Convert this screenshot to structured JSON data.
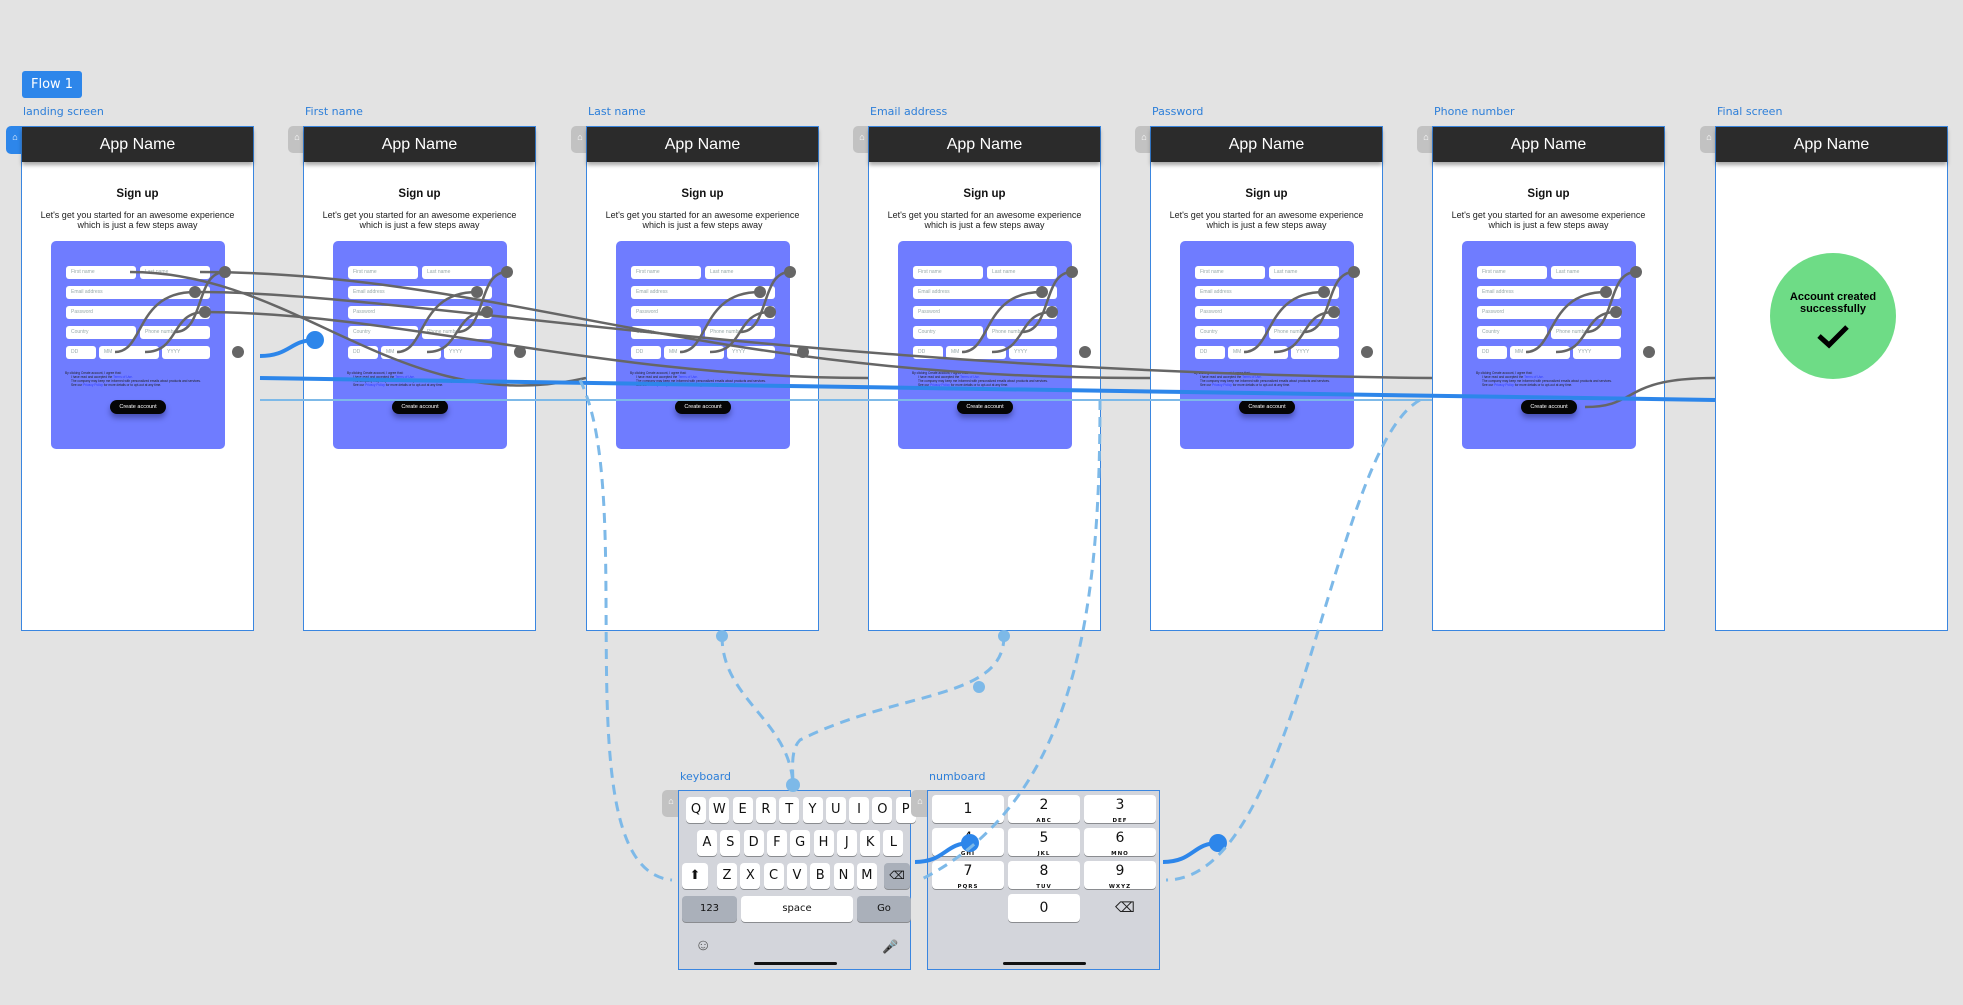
{
  "flow": {
    "label": "Flow 1"
  },
  "app_name": "App Name",
  "signup": {
    "title": "Sign up",
    "subtitle_line1": "Let's get you started for an awesome experience",
    "subtitle_line2": "which is just a few steps away",
    "placeholders": {
      "first_name": "First name",
      "last_name": "Last name",
      "email": "Email address",
      "password": "Password",
      "country": "Country",
      "phone": "Phone number",
      "day": "DD",
      "month": "MM",
      "year": "YYYY"
    },
    "legal": {
      "intro": "By clicking Create account, I agree that:",
      "line1_prefix": "I have read and accepted the ",
      "line1_link": "Terms of Use.",
      "line2": "The company may keep me informed with personalized emails about products and services.",
      "line3_prefix": "See our ",
      "line3_link": "Privacy Policy",
      "line3_suffix": " for more details or to opt-out at any time."
    },
    "create_button": "Create account"
  },
  "screens": [
    {
      "label": "landing screen",
      "is_start": true
    },
    {
      "label": "First name"
    },
    {
      "label": "Last name"
    },
    {
      "label": "Email address"
    },
    {
      "label": "Password"
    },
    {
      "label": "Phone number"
    },
    {
      "label": "Final screen"
    }
  ],
  "final_screen": {
    "message_line1": "Account created",
    "message_line2": "successfully",
    "icon": "checkmark-icon"
  },
  "keyboard": {
    "label": "keyboard",
    "row1": [
      "Q",
      "W",
      "E",
      "R",
      "T",
      "Y",
      "U",
      "I",
      "O",
      "P"
    ],
    "row2": [
      "A",
      "S",
      "D",
      "F",
      "G",
      "H",
      "J",
      "K",
      "L"
    ],
    "row3": [
      "Z",
      "X",
      "C",
      "V",
      "B",
      "N",
      "M"
    ],
    "numbers_key": "123",
    "space_key": "space",
    "go_key": "Go"
  },
  "numboard": {
    "label": "numboard",
    "keys": [
      {
        "digit": "1",
        "letters": ""
      },
      {
        "digit": "2",
        "letters": "ABC"
      },
      {
        "digit": "3",
        "letters": "DEF"
      },
      {
        "digit": "4",
        "letters": "GHI"
      },
      {
        "digit": "5",
        "letters": "JKL"
      },
      {
        "digit": "6",
        "letters": "MNO"
      },
      {
        "digit": "7",
        "letters": "PQRS"
      },
      {
        "digit": "8",
        "letters": "TUV"
      },
      {
        "digit": "9",
        "letters": "WXYZ"
      },
      {
        "digit": "0",
        "letters": ""
      }
    ]
  },
  "colors": {
    "accent": "#2d86ea",
    "card": "#6f7cff",
    "appbar": "#2b2b2b",
    "success": "#6edc86",
    "wire": "#666666",
    "wire_light": "#7db9e8"
  }
}
